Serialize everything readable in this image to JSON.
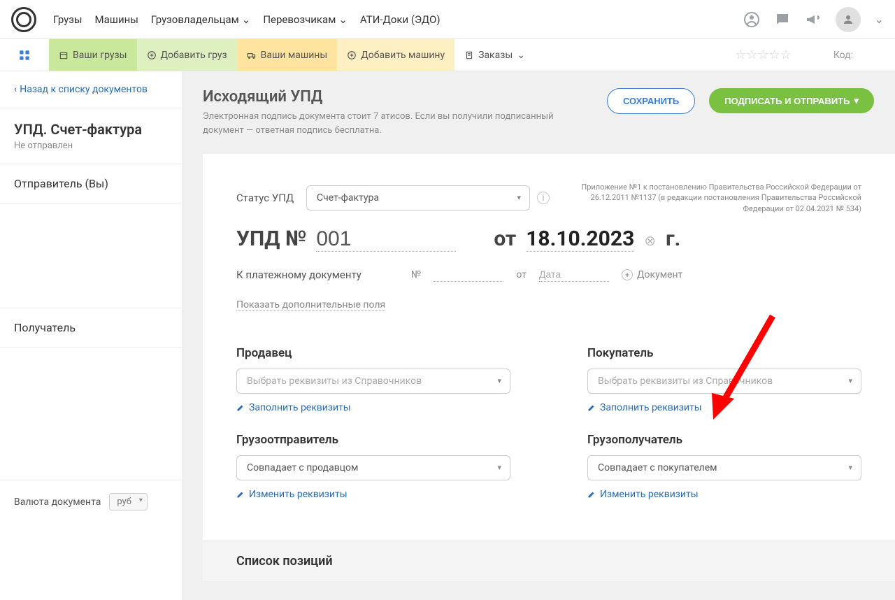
{
  "topnav": {
    "links": [
      "Грузы",
      "Машины",
      "Грузовладельцам",
      "Перевозчикам",
      "АТИ-Доки (ЭДО)"
    ]
  },
  "subnav": {
    "your_cargo": "Ваши грузы",
    "add_cargo": "Добавить груз",
    "your_vehicles": "Ваши машины",
    "add_vehicle": "Добавить машину",
    "orders": "Заказы",
    "code": "Код:"
  },
  "sidebar": {
    "back": "Назад к списку документов",
    "doc_title": "УПД. Счет-фактура",
    "doc_status": "Не отправлен",
    "sender": "Отправитель (Вы)",
    "recipient": "Получатель",
    "currency_label": "Валюта документа",
    "currency_value": "руб"
  },
  "header": {
    "title": "Исходящий УПД",
    "subtitle": "Электронная подпись документа стоит 7 атисов. Если вы получили подписанный документ — ответная подпись бесплатна.",
    "save": "СОХРАНИТЬ",
    "sign_send": "ПОДПИСАТЬ И ОТПРАВИТЬ"
  },
  "form": {
    "status_label": "Статус УПД",
    "status_value": "Счет-фактура",
    "legal": "Приложение №1 к постановлению Правительства Российской Федерации от 26.12.2011 №1137 (в редакции постановления Правительства Российской Федерации от 02.04.2021 № 534)",
    "upd_no_label": "УПД №",
    "upd_no_value": "001",
    "from_label": "от",
    "date_value": "18.10.2023",
    "year_suffix": "г.",
    "pay_doc_label": "К платежному документу",
    "num_label": "№",
    "from2_label": "от",
    "date_placeholder": "Дата",
    "add_doc": "Документ",
    "show_more": "Показать дополнительные поля",
    "seller": {
      "title": "Продавец",
      "placeholder": "Выбрать реквизиты из Справочников",
      "fill": "Заполнить реквизиты",
      "shipper_title": "Грузоотправитель",
      "shipper_value": "Совпадает с продавцом",
      "change": "Изменить реквизиты"
    },
    "buyer": {
      "title": "Покупатель",
      "placeholder": "Выбрать реквизиты из Справочников",
      "fill": "Заполнить реквизиты",
      "consignee_title": "Грузополучатель",
      "consignee_value": "Совпадает с покупателем",
      "change": "Изменить реквизиты"
    },
    "positions_title": "Список позиций"
  }
}
